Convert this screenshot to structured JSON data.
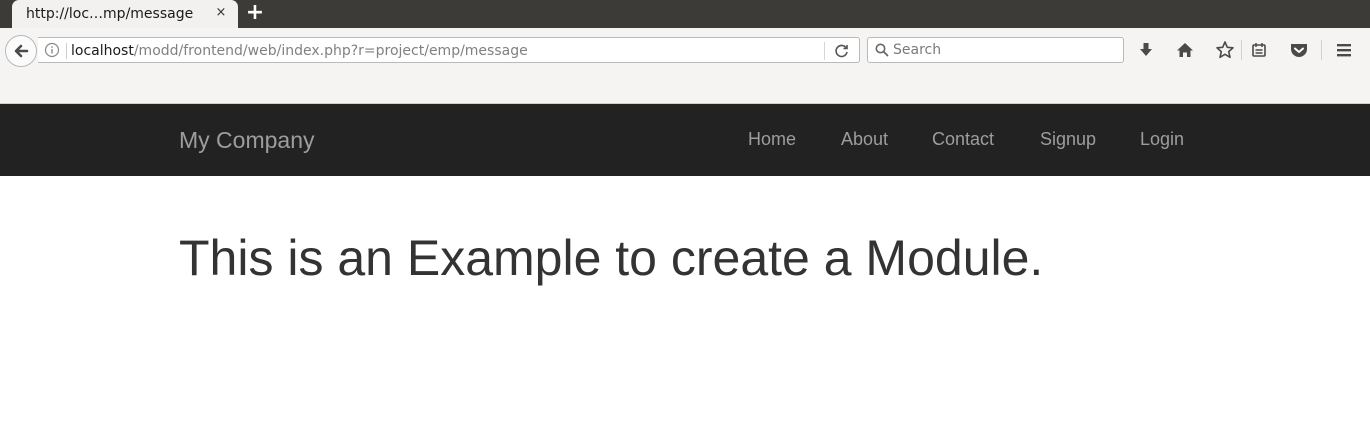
{
  "browser": {
    "tab": {
      "title": "http://loc…mp/message",
      "close": "×"
    },
    "new_tab": "+",
    "url": {
      "host": "localhost",
      "path": "/modd/frontend/web/index.php?r=project/emp/message"
    },
    "search": {
      "placeholder": "Search"
    },
    "toolbar_icons": [
      "download-icon",
      "home-icon",
      "bookmark-star-icon",
      "reading-list-icon",
      "pocket-icon",
      "menu-icon"
    ]
  },
  "site": {
    "brand": "My Company",
    "nav": [
      {
        "label": "Home"
      },
      {
        "label": "About"
      },
      {
        "label": "Contact"
      },
      {
        "label": "Signup"
      },
      {
        "label": "Login"
      }
    ]
  },
  "content": {
    "heading": "This is an Example to create a Module."
  },
  "colors": {
    "navbar_bg": "#222222",
    "navbar_text": "#9d9d9d",
    "heading_text": "#333333",
    "tabstrip_bg": "#3c3b37"
  }
}
